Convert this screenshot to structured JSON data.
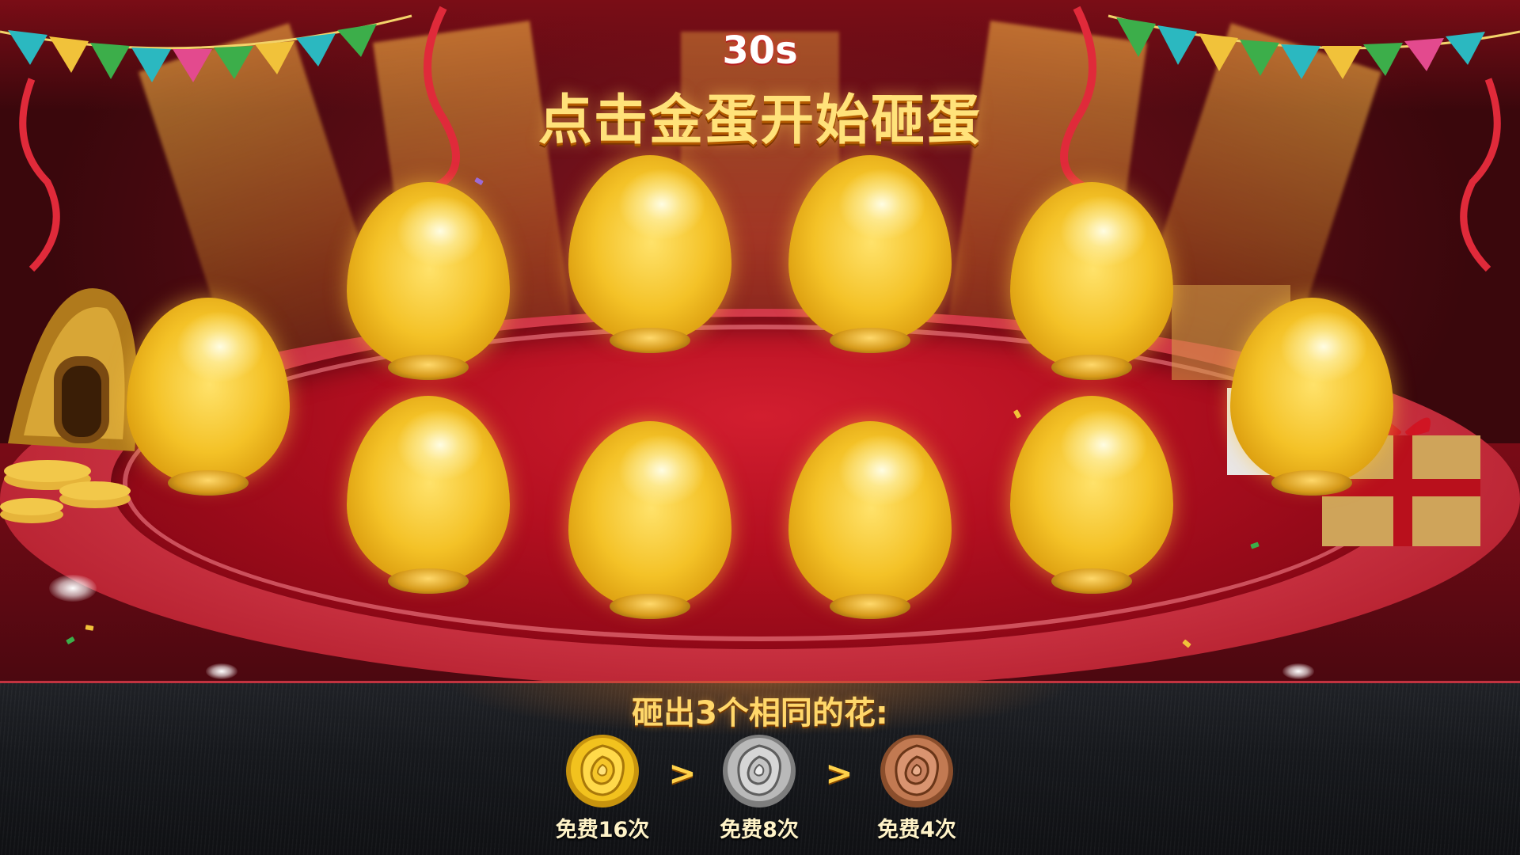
{
  "game": {
    "timer": "30s",
    "title": "点击金蛋开始砸蛋",
    "eggs": [
      {
        "id": 1
      },
      {
        "id": 2
      },
      {
        "id": 3
      },
      {
        "id": 4
      },
      {
        "id": 5
      },
      {
        "id": 6
      },
      {
        "id": 7
      },
      {
        "id": 8
      },
      {
        "id": 9
      },
      {
        "id": 10
      }
    ]
  },
  "rules": {
    "title": "砸出3个相同的花:",
    "separator": ">",
    "rewards": [
      {
        "flower": "gold-rose-icon",
        "color": "#f2c21e",
        "label": "免费16次"
      },
      {
        "flower": "silver-rose-icon",
        "color": "#b9b9b9",
        "label": "免费8次"
      },
      {
        "flower": "bronze-rose-icon",
        "color": "#c27a52",
        "label": "免费4次"
      }
    ]
  },
  "colors": {
    "accent_gold": "#ffe27a",
    "stage_red": "#b30f20",
    "panel_dark": "#16181c"
  }
}
